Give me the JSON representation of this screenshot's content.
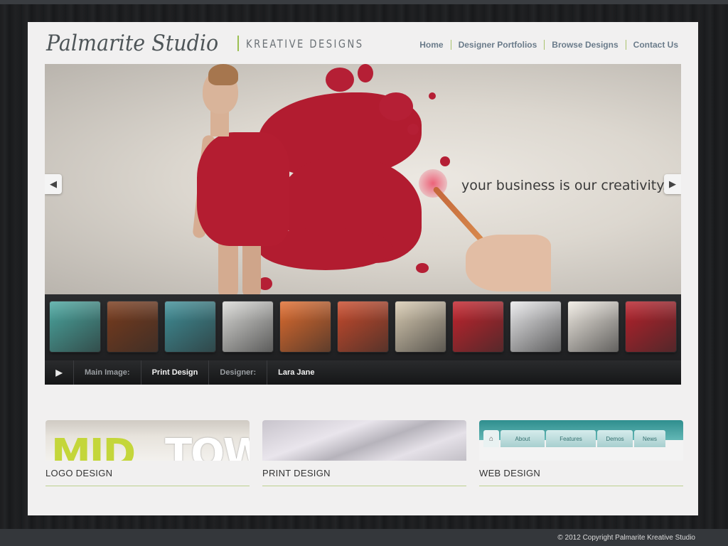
{
  "header": {
    "logo_script": "Palmarite Studio",
    "logo_tagline": "KREATIVE DESIGNS"
  },
  "nav": {
    "items": [
      "Home",
      "Designer Portfolios",
      "Browse Designs",
      "Contact Us"
    ]
  },
  "hero": {
    "caption": "your business is our creativity...",
    "prev_icon": "chevron-left-icon",
    "next_icon": "chevron-right-icon"
  },
  "thumbnails": {
    "items": [
      {
        "icon": "teal-cards-thumb",
        "color": "#4aa7a0"
      },
      {
        "icon": "bokeh-thumb",
        "color": "#7a3b1c"
      },
      {
        "icon": "circle-graphic-thumb",
        "color": "#3f8f98"
      },
      {
        "icon": "business-card-thumb",
        "color": "#d9d9d6"
      },
      {
        "icon": "orange-card-thumb",
        "color": "#e06c2e"
      },
      {
        "icon": "retro-stripes-thumb",
        "color": "#c94a2b"
      },
      {
        "icon": "coffee-pattern-thumb",
        "color": "#d8cbb2"
      },
      {
        "icon": "eps10-thumb",
        "color": "#c4232c"
      },
      {
        "icon": "website-thumb",
        "color": "#e8e8ea"
      },
      {
        "icon": "emblem-thumb",
        "color": "#efeae2"
      },
      {
        "icon": "cutlery-thumb",
        "color": "#b8202a"
      }
    ]
  },
  "infobar": {
    "play_icon": "play-icon",
    "main_image_label": "Main Image:",
    "main_image_value": "Print Design",
    "designer_label": "Designer:",
    "designer_value": "Lara Jane"
  },
  "categories": [
    {
      "title": "LOGO DESIGN",
      "image_text_1": "MID",
      "image_text_2": "TOW"
    },
    {
      "title": "PRINT DESIGN"
    },
    {
      "title": "WEB DESIGN",
      "tabs": [
        "About",
        "Features",
        "Demos",
        "News"
      ]
    }
  ],
  "footer": {
    "copyright": "© 2012 Copyright  Palmarite Kreative Studio"
  },
  "colors": {
    "accent_green": "#9bbf52",
    "nav_text": "#6a7b8a",
    "dress_red": "#b41d31"
  }
}
